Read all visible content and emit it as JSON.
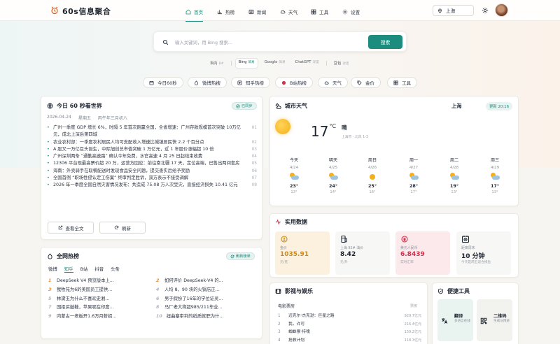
{
  "app": {
    "title": "60s信息聚合"
  },
  "nav": {
    "items": [
      {
        "label": "首页",
        "icon": "home-icon",
        "active": true
      },
      {
        "label": "热榜",
        "icon": "bar-chart-icon"
      },
      {
        "label": "新闻",
        "icon": "newspaper-icon"
      },
      {
        "label": "天气",
        "icon": "cloud-icon"
      },
      {
        "label": "工具",
        "icon": "grid-icon"
      },
      {
        "label": "设置",
        "icon": "gear-icon"
      }
    ],
    "city": "上海"
  },
  "search": {
    "placeholder": "输入关键词，用 Bing 搜索...",
    "button": "搜索",
    "engines": [
      {
        "name": "百内",
        "shortcut": "B#",
        "active": false
      },
      {
        "name": "Bing",
        "shortcut": "简易",
        "active": true
      },
      {
        "name": "Google",
        "shortcut": "简易",
        "active": false
      },
      {
        "name": "ChatGPT",
        "shortcut": "深度",
        "active": false
      },
      {
        "name": "豆包",
        "shortcut": "对话",
        "active": false
      }
    ]
  },
  "quick_links": [
    {
      "label": "今日60秒",
      "icon": "calendar-icon"
    },
    {
      "label": "微博热搜",
      "icon": "flame-icon"
    },
    {
      "label": "知乎热榜",
      "icon": "zhihu-icon"
    },
    {
      "label": "B站热榜",
      "icon": "bilibili-icon"
    },
    {
      "label": "天气",
      "icon": "cloud-icon"
    },
    {
      "label": "金价",
      "icon": "tag-icon"
    },
    {
      "label": "工具",
      "icon": "grid-icon"
    }
  ],
  "news": {
    "title": "今日 60 秒看世界",
    "badge": "已同步",
    "date": "2026-04-24",
    "weekday": "星期五",
    "lunar": "丙午年三月初八",
    "items": [
      {
        "text": "广州一季度 GDP 增长 6%，时隔 5 年首次跑赢全国，全省增速：广州存款规模首次突破 10万亿元，成北上深后第四城",
        "num": "01"
      },
      {
        "text": "农业农村部：一季度农村居民人均可支配收入增速比城镇居民快 2.2 个百分点",
        "num": "02"
      },
      {
        "text": "A 股又一万亿巨头诞生，中际旭创总市值突破 1 万亿元，近 1 年股价涨幅超 10 倍",
        "num": "03"
      },
      {
        "text": "广州深圳两条 “通勤高速路” 确认今年免费，水官高速 4 月 25 日起结束收费",
        "num": "04"
      },
      {
        "text": "12306 平台现最高票价超 20 万，运营方回应：前往南北疆 17 天，定位高端，已售出两间套房",
        "num": "05"
      },
      {
        "text": "海南：外卖骑手在取餐配送时发现食品安全问题，提交查实后给予奖励",
        "num": "06"
      },
      {
        "text": "全国首例 “职场性侵认定工伤案” 终审判定胜诉，双方表示不接受调解",
        "num": "07"
      },
      {
        "text": "2026 年一季度全国自然灾害情况发布：共造成 75.08 万人次受灾，直接经济损失 10.41 亿元",
        "num": "08"
      }
    ],
    "btn_full": "查看全文",
    "btn_refresh": "刷新"
  },
  "weather": {
    "title": "城市天气",
    "city": "上海",
    "updated": "更新 20:16",
    "temp": "17",
    "unit": "°C",
    "condition": "晴",
    "meta": "上海市 · 北风 1-3",
    "forecast": [
      {
        "day": "今天",
        "date": "4/24",
        "icon": "partly-cloudy-icon",
        "hi": "23°",
        "lo": "13°"
      },
      {
        "day": "明天",
        "date": "4/25",
        "icon": "partly-cloudy-icon",
        "hi": "24°",
        "lo": "14°"
      },
      {
        "day": "周日",
        "date": "4/26",
        "icon": "sun-icon",
        "hi": "25°",
        "lo": "16°"
      },
      {
        "day": "周一",
        "date": "4/27",
        "icon": "partly-cloudy-icon",
        "hi": "28°",
        "lo": "17°"
      },
      {
        "day": "周二",
        "date": "4/28",
        "icon": "partly-cloudy-icon",
        "hi": "19°",
        "lo": "13°"
      },
      {
        "day": "周三",
        "date": "4/29",
        "icon": "partly-cloudy-icon",
        "hi": "17°",
        "lo": "13°"
      }
    ]
  },
  "stats": {
    "title": "实用数据",
    "items": [
      {
        "label": "金价",
        "value": "1035.91",
        "sub": "元/克",
        "color": "#c98a1e",
        "bg": "#fbf1de",
        "icon": "gold-icon"
      },
      {
        "label": "上海 92# 油价",
        "value": "8.42",
        "sub": "元/升",
        "color": "#1e2530",
        "bg": "#f7f7f5",
        "icon": "fuel-icon"
      },
      {
        "label": "美元人民币",
        "value": "6.8439",
        "sub": "实时汇率",
        "color": "#d0324b",
        "bg": "#fbe9ec",
        "icon": "currency-icon"
      },
      {
        "label": "距离周末",
        "value": "10 分钟",
        "sub": "今天是周五适合摸鱼",
        "color": "#1e2530",
        "bg": "#f7f7f5",
        "icon": "clock-icon"
      }
    ]
  },
  "hot": {
    "title": "全网热榜",
    "refresh": "刷新榜单",
    "tabs": [
      "微博",
      "知乎",
      "B站",
      "抖音",
      "头条"
    ],
    "active_tab": 1,
    "left": [
      {
        "rank": "1",
        "text": "DeepSeek V4 预览版本上..."
      },
      {
        "rank": "3",
        "text": "我牧苑为6的美国员工提供..."
      },
      {
        "rank": "5",
        "text": "林黛玉为什么不喜欢史湘..."
      },
      {
        "rank": "7",
        "text": "国拒买鼓鞋，苹果呢在印度..."
      },
      {
        "rank": "9",
        "text": "内蒙古一老板开1.6万月薪招..."
      }
    ],
    "right": [
      {
        "rank": "2",
        "text": "如何评价 DeepSeek-V4 的..."
      },
      {
        "rank": "4",
        "text": "人均 8、90 块的火锅店正..."
      },
      {
        "rank": "6",
        "text": "男子假扮了16年的学位证灵..."
      },
      {
        "rank": "8",
        "text": "马厂老大称超985/211毕业..."
      },
      {
        "rank": "10",
        "text": "扭曲塞审判的纸质就职为什..."
      }
    ]
  },
  "entertainment": {
    "title": "影视与娱乐",
    "section": "电影票房",
    "col": "票房",
    "rows": [
      {
        "rank": "1",
        "title": "迈克尔·杰克逊：巨星之路",
        "value": "929.7亿元"
      },
      {
        "rank": "2",
        "title": "我，许可",
        "value": "216.4亿元"
      },
      {
        "rank": "3",
        "title": "蜘蛛猴·持魂",
        "value": "159.2亿元"
      },
      {
        "rank": "4",
        "title": "抢救计划",
        "value": "118.3亿元"
      }
    ]
  },
  "tools": {
    "title": "便捷工具",
    "items": [
      {
        "name": "翻译",
        "desc": "多语言在线",
        "icon": "translate-icon",
        "bg": "#e9f3ef"
      },
      {
        "name": "二维码",
        "desc": "生成与预览",
        "icon": "qrcode-icon",
        "bg": "#f2f2ef"
      }
    ]
  }
}
